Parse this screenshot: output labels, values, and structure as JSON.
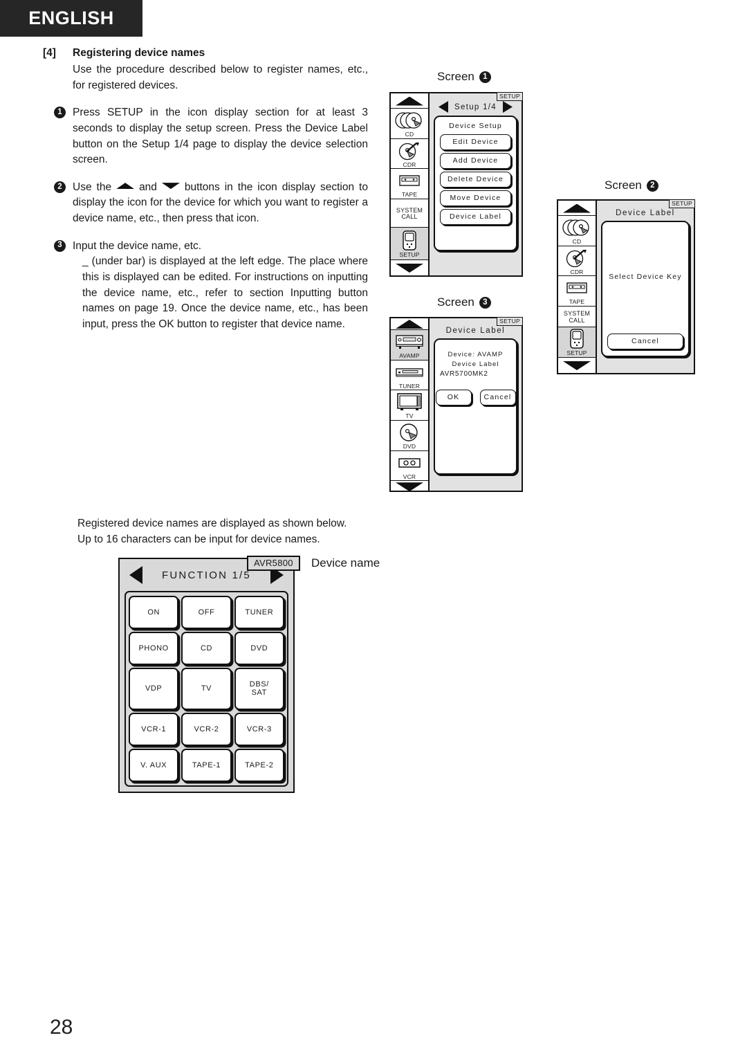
{
  "header": {
    "language_banner": "ENGLISH"
  },
  "section": {
    "number": "[4]",
    "title": "Registering device names",
    "intro": "Use the procedure described below to register names, etc., for registered devices."
  },
  "steps": [
    {
      "bullet": "1",
      "text": "Press  SETUP  in the icon display section for at least 3 seconds to display the setup screen. Press the  Device Label  button on the  Setup 1/4  page to display the device selection screen."
    },
    {
      "bullet": "2",
      "text_before": "Use the",
      "text_middle": "and",
      "text_after": "buttons in the icon display section to display the icon for the device for which you want to register a device name, etc., then press that icon."
    },
    {
      "bullet": "3",
      "line1": "Input the device name, etc.",
      "text": "_  (under bar) is displayed at the left edge.  The place where this is displayed can be edited. For instructions on inputting the device name, etc., refer to section  Inputting button names  on page 19. Once the device name, etc., has been input, press the  OK  button to register that device name."
    }
  ],
  "below_note": {
    "line1": "Registered device names are displayed as shown below.",
    "line2": "Up to 16 characters can be input for device names."
  },
  "screen1": {
    "caption": "Screen",
    "caption_bullet": "1",
    "setup_tag": "SETUP",
    "pager_label": "Setup 1/4",
    "list_title": "Device Setup",
    "buttons": [
      "Edit Device",
      "Add Device",
      "Delete Device",
      "Move Device",
      "Device Label"
    ],
    "icons": [
      {
        "name": "CD",
        "art": "cd-stack-icon",
        "selected": false
      },
      {
        "name": "CDR",
        "art": "cdr-icon",
        "selected": false
      },
      {
        "name": "TAPE",
        "art": "tape-icon",
        "selected": false
      },
      {
        "name": "SYSTEM CALL",
        "art": "",
        "selected": false
      },
      {
        "name": "SETUP",
        "art": "remote-icon",
        "selected": true
      }
    ]
  },
  "screen2": {
    "caption": "Screen",
    "caption_bullet": "2",
    "setup_tag": "SETUP",
    "title": "Device Label",
    "body_text": "Select Device Key",
    "cancel_label": "Cancel",
    "icons": [
      {
        "name": "CD",
        "art": "cd-stack-icon",
        "selected": false
      },
      {
        "name": "CDR",
        "art": "cdr-icon",
        "selected": false
      },
      {
        "name": "TAPE",
        "art": "tape-icon",
        "selected": false
      },
      {
        "name": "SYSTEM CALL",
        "art": "",
        "selected": false
      },
      {
        "name": "SETUP",
        "art": "remote-icon",
        "selected": true
      }
    ]
  },
  "screen3": {
    "caption": "Screen",
    "caption_bullet": "3",
    "setup_tag": "SETUP",
    "title": "Device Label",
    "device_line": "Device: AVAMP",
    "label_line": "Device Label",
    "value_line": "AVR5700MK2",
    "ok_label": "OK",
    "cancel_label": "Cancel",
    "icons": [
      {
        "name": "AVAMP",
        "art": "avamp-icon",
        "selected": true
      },
      {
        "name": "TUNER",
        "art": "tuner-icon",
        "selected": false
      },
      {
        "name": "TV",
        "art": "tv-icon",
        "selected": false
      },
      {
        "name": "DVD",
        "art": "dvd-icon",
        "selected": false
      },
      {
        "name": "VCR",
        "art": "vcr-icon",
        "selected": false
      }
    ]
  },
  "function_panel": {
    "pager_label": "FUNCTION  1/5",
    "device_tag": "AVR5800",
    "device_name_caption": "Device name",
    "buttons": [
      "ON",
      "OFF",
      "TUNER",
      "PHONO",
      "CD",
      "DVD",
      "VDP",
      "TV",
      "DBS/\nSAT",
      "VCR-1",
      "VCR-2",
      "VCR-3",
      "V. AUX",
      "TAPE-1",
      "TAPE-2"
    ]
  },
  "page_number": "28"
}
